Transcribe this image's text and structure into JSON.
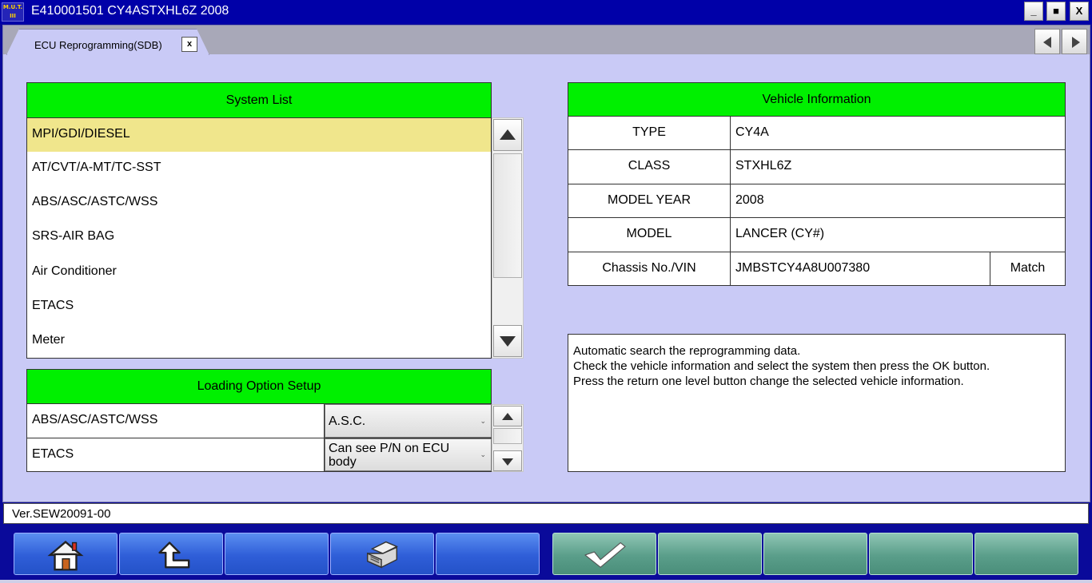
{
  "window": {
    "logo_text": "M.U.T. III",
    "title": "E410001501   CY4ASTXHL6Z 2008",
    "minimize_label": "_",
    "maximize_label": "■",
    "close_label": "X"
  },
  "tab": {
    "label": "ECU Reprogramming(SDB)",
    "close_label": "x"
  },
  "system_list": {
    "header": "System List",
    "items": [
      {
        "label": "MPI/GDI/DIESEL",
        "selected": true
      },
      {
        "label": "AT/CVT/A-MT/TC-SST",
        "selected": false
      },
      {
        "label": "ABS/ASC/ASTC/WSS",
        "selected": false
      },
      {
        "label": "SRS-AIR BAG",
        "selected": false
      },
      {
        "label": "Air Conditioner",
        "selected": false
      },
      {
        "label": "ETACS",
        "selected": false
      },
      {
        "label": "Meter",
        "selected": false
      }
    ]
  },
  "loading_option": {
    "header": "Loading Option Setup",
    "rows": [
      {
        "system": "ABS/ASC/ASTC/WSS",
        "value": "A.S.C."
      },
      {
        "system": "ETACS",
        "value": "Can see P/N on ECU body"
      }
    ]
  },
  "vehicle_info": {
    "header": "Vehicle Information",
    "rows": [
      {
        "label": "TYPE",
        "value": "CY4A"
      },
      {
        "label": "CLASS",
        "value": "STXHL6Z"
      },
      {
        "label": "MODEL YEAR",
        "value": "2008"
      },
      {
        "label": "MODEL",
        "value": "LANCER (CY#)"
      },
      {
        "label": "Chassis No./VIN",
        "value": "JMBSTCY4A8U007380",
        "action": "Match"
      }
    ]
  },
  "message": {
    "lines": [
      "Automatic search the reprogramming data.",
      "Check the vehicle information and select the system then press the OK button.",
      "Press the return one level button change the selected vehicle information."
    ]
  },
  "version": "Ver.SEW20091-00",
  "toolbar": {
    "buttons": [
      {
        "icon": "home-icon",
        "color": "#2f5ed8"
      },
      {
        "icon": "return-arrow-icon",
        "color": "#2f5ed8"
      },
      {
        "icon": "",
        "color": "#2f5ed8"
      },
      {
        "icon": "printer-icon",
        "color": "#2f5ed8"
      },
      {
        "icon": "",
        "color": "#2f5ed8"
      },
      {
        "icon": "checkmark-icon",
        "color": "#5a9e8a"
      },
      {
        "icon": "",
        "color": "#5a9e8a"
      },
      {
        "icon": "",
        "color": "#5a9e8a"
      },
      {
        "icon": "",
        "color": "#5a9e8a"
      },
      {
        "icon": "",
        "color": "#5a9e8a"
      }
    ]
  },
  "colors": {
    "header_green": "#00f000",
    "selected_row": "#f0e68c",
    "panel_background": "#c9caf6",
    "title_bar": "#0000a8"
  }
}
